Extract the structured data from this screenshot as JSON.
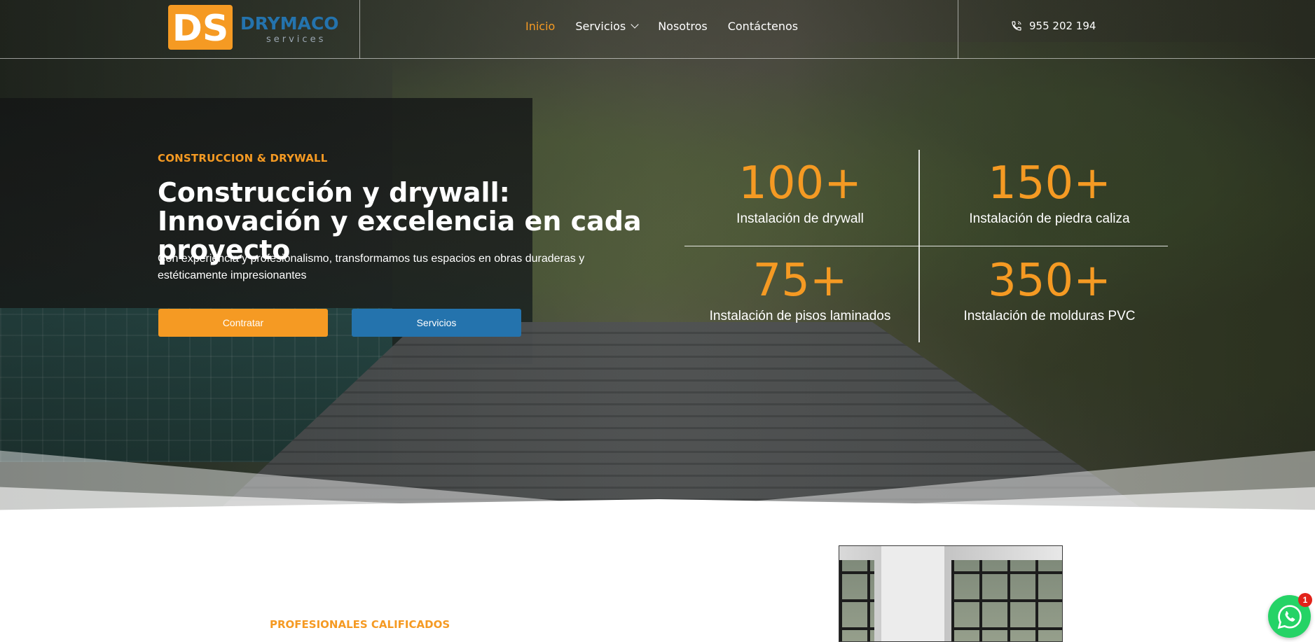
{
  "header": {
    "logo": {
      "monogram": "DS",
      "brand": "DRYMACO",
      "tagline": "services"
    },
    "nav": [
      {
        "label": "Inicio",
        "active": true
      },
      {
        "label": "Servicios",
        "has_dropdown": true
      },
      {
        "label": "Nosotros"
      },
      {
        "label": "Contáctenos"
      }
    ],
    "phone": "955 202 194",
    "phone_icon": "phone-icon"
  },
  "hero": {
    "kicker": "CONSTRUCCION & DRYWALL",
    "title": "Construcción y drywall: Innovación y excelencia en cada proyecto",
    "description": "Con experiencia y profesionalismo, transformamos tus espacios en obras duraderas y estéticamente impresionantes",
    "buttons": {
      "primary": "Contratar",
      "secondary": "Servicios"
    }
  },
  "stats": [
    {
      "value": "100+",
      "label": "Instalación de drywall"
    },
    {
      "value": "150+",
      "label": "Instalación de piedra caliza"
    },
    {
      "value": "75+",
      "label": "Instalación de pisos laminados"
    },
    {
      "value": "350+",
      "label": "Instalación de molduras PVC"
    }
  ],
  "section": {
    "kicker": "PROFESIONALES CALIFICADOS"
  },
  "whatsapp": {
    "icon": "whatsapp-icon",
    "badge": "1"
  },
  "colors": {
    "accent": "#f59a23",
    "blue": "#2473ad",
    "whatsapp": "#25d366",
    "badge": "#e2231a"
  }
}
